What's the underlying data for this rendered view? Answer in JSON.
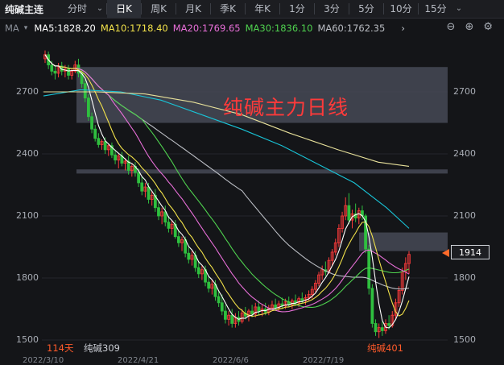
{
  "toolbar": {
    "title": "纯碱主连",
    "items": [
      {
        "label": "分时",
        "active": false,
        "width": 40,
        "chev": false
      },
      {
        "label": "⌄",
        "active": false,
        "width": 16,
        "chev": true
      },
      {
        "label": "日K",
        "active": true,
        "width": 42,
        "chev": false
      },
      {
        "label": "周K",
        "active": false,
        "width": 42,
        "chev": false
      },
      {
        "label": "月K",
        "active": false,
        "width": 42,
        "chev": false
      },
      {
        "label": "季K",
        "active": false,
        "width": 42,
        "chev": false
      },
      {
        "label": "年K",
        "active": false,
        "width": 42,
        "chev": false
      },
      {
        "label": "1分",
        "active": false,
        "width": 42,
        "chev": false
      },
      {
        "label": "3分",
        "active": false,
        "width": 42,
        "chev": false
      },
      {
        "label": "5分",
        "active": false,
        "width": 42,
        "chev": false
      },
      {
        "label": "10分",
        "active": false,
        "width": 42,
        "chev": false
      },
      {
        "label": "15分",
        "active": false,
        "width": 42,
        "chev": false
      },
      {
        "label": "⌄",
        "active": false,
        "width": 16,
        "chev": true
      }
    ]
  },
  "ma_bar": {
    "label": "MA",
    "caret": "▾",
    "items": [
      {
        "text": "MA5:1828.20",
        "color": "#ffffff"
      },
      {
        "text": "MA10:1718.40",
        "color": "#f2e24a"
      },
      {
        "text": "MA20:1769.65",
        "color": "#e86fd8"
      },
      {
        "text": "MA30:1836.10",
        "color": "#4fd24f"
      },
      {
        "text": "MA60:1762.35",
        "color": "#b9bcc2"
      }
    ],
    "arrow": "›",
    "tools": [
      "⊖",
      "⊕",
      "⚙"
    ]
  },
  "y_axis_labels": [
    "2700",
    "2400",
    "2100",
    "1800",
    "1500"
  ],
  "price_tag": "1914",
  "title": "纯碱主力日线",
  "bottom": {
    "days": "114天",
    "left_contract": "纯碱309",
    "right_contract": "纯碱401"
  },
  "dates": [
    "2022/3/10",
    "2022/4/21",
    "2022/6/6",
    "2022/7/19"
  ],
  "colors": {
    "up": "#ff3b3b",
    "down": "#2fbf3f",
    "ma5": "#ffffff",
    "ma10": "#f2e24a",
    "ma20": "#e86fd8",
    "ma30": "#4fd24f",
    "ma60": "#b9bcc2",
    "ma_long1": "#19c3d6",
    "ma_long2": "#e7e09a",
    "zone": "#484c5a"
  },
  "chart_data": {
    "type": "candlestick",
    "y_ticks": [
      2700,
      2400,
      2100,
      1800,
      1500
    ],
    "last_price": 1914,
    "zones": [
      [
        2550,
        2820
      ],
      [
        2305,
        2325
      ],
      [
        1930,
        2020
      ]
    ],
    "candles": [
      {
        "o": 2860,
        "h": 2900,
        "l": 2840,
        "c": 2880
      },
      {
        "o": 2880,
        "h": 2895,
        "l": 2810,
        "c": 2830
      },
      {
        "o": 2830,
        "h": 2850,
        "l": 2780,
        "c": 2800
      },
      {
        "o": 2800,
        "h": 2830,
        "l": 2760,
        "c": 2790
      },
      {
        "o": 2790,
        "h": 2840,
        "l": 2770,
        "c": 2825
      },
      {
        "o": 2825,
        "h": 2845,
        "l": 2780,
        "c": 2800
      },
      {
        "o": 2800,
        "h": 2830,
        "l": 2770,
        "c": 2810
      },
      {
        "o": 2810,
        "h": 2830,
        "l": 2760,
        "c": 2780
      },
      {
        "o": 2780,
        "h": 2810,
        "l": 2760,
        "c": 2800
      },
      {
        "o": 2800,
        "h": 2850,
        "l": 2790,
        "c": 2830
      },
      {
        "o": 2830,
        "h": 2860,
        "l": 2770,
        "c": 2790
      },
      {
        "o": 2790,
        "h": 2810,
        "l": 2720,
        "c": 2740
      },
      {
        "o": 2740,
        "h": 2760,
        "l": 2650,
        "c": 2670
      },
      {
        "o": 2670,
        "h": 2690,
        "l": 2560,
        "c": 2580
      },
      {
        "o": 2580,
        "h": 2600,
        "l": 2500,
        "c": 2520
      },
      {
        "o": 2520,
        "h": 2540,
        "l": 2460,
        "c": 2475
      },
      {
        "o": 2475,
        "h": 2500,
        "l": 2430,
        "c": 2445
      },
      {
        "o": 2445,
        "h": 2470,
        "l": 2420,
        "c": 2460
      },
      {
        "o": 2460,
        "h": 2480,
        "l": 2400,
        "c": 2420
      },
      {
        "o": 2420,
        "h": 2450,
        "l": 2390,
        "c": 2440
      },
      {
        "o": 2440,
        "h": 2455,
        "l": 2380,
        "c": 2395
      },
      {
        "o": 2395,
        "h": 2420,
        "l": 2350,
        "c": 2370
      },
      {
        "o": 2370,
        "h": 2400,
        "l": 2330,
        "c": 2390
      },
      {
        "o": 2390,
        "h": 2410,
        "l": 2340,
        "c": 2355
      },
      {
        "o": 2355,
        "h": 2380,
        "l": 2320,
        "c": 2365
      },
      {
        "o": 2365,
        "h": 2390,
        "l": 2300,
        "c": 2320
      },
      {
        "o": 2320,
        "h": 2350,
        "l": 2290,
        "c": 2340
      },
      {
        "o": 2340,
        "h": 2360,
        "l": 2290,
        "c": 2310
      },
      {
        "o": 2310,
        "h": 2330,
        "l": 2240,
        "c": 2260
      },
      {
        "o": 2260,
        "h": 2290,
        "l": 2200,
        "c": 2220
      },
      {
        "o": 2220,
        "h": 2260,
        "l": 2190,
        "c": 2240
      },
      {
        "o": 2240,
        "h": 2260,
        "l": 2160,
        "c": 2180
      },
      {
        "o": 2180,
        "h": 2220,
        "l": 2150,
        "c": 2200
      },
      {
        "o": 2200,
        "h": 2230,
        "l": 2120,
        "c": 2140
      },
      {
        "o": 2140,
        "h": 2170,
        "l": 2080,
        "c": 2100
      },
      {
        "o": 2100,
        "h": 2140,
        "l": 2060,
        "c": 2120
      },
      {
        "o": 2120,
        "h": 2150,
        "l": 2050,
        "c": 2070
      },
      {
        "o": 2070,
        "h": 2100,
        "l": 2020,
        "c": 2040
      },
      {
        "o": 2040,
        "h": 2080,
        "l": 2010,
        "c": 2060
      },
      {
        "o": 2060,
        "h": 2080,
        "l": 1990,
        "c": 2000
      },
      {
        "o": 2000,
        "h": 2030,
        "l": 1950,
        "c": 1970
      },
      {
        "o": 1970,
        "h": 2000,
        "l": 1930,
        "c": 1985
      },
      {
        "o": 1985,
        "h": 2000,
        "l": 1900,
        "c": 1920
      },
      {
        "o": 1920,
        "h": 1950,
        "l": 1870,
        "c": 1890
      },
      {
        "o": 1890,
        "h": 1930,
        "l": 1860,
        "c": 1910
      },
      {
        "o": 1910,
        "h": 1930,
        "l": 1830,
        "c": 1850
      },
      {
        "o": 1850,
        "h": 1880,
        "l": 1800,
        "c": 1820
      },
      {
        "o": 1820,
        "h": 1860,
        "l": 1790,
        "c": 1840
      },
      {
        "o": 1840,
        "h": 1860,
        "l": 1760,
        "c": 1780
      },
      {
        "o": 1780,
        "h": 1810,
        "l": 1730,
        "c": 1750
      },
      {
        "o": 1750,
        "h": 1790,
        "l": 1720,
        "c": 1770
      },
      {
        "o": 1770,
        "h": 1790,
        "l": 1690,
        "c": 1710
      },
      {
        "o": 1710,
        "h": 1740,
        "l": 1660,
        "c": 1680
      },
      {
        "o": 1680,
        "h": 1720,
        "l": 1620,
        "c": 1640
      },
      {
        "o": 1640,
        "h": 1670,
        "l": 1580,
        "c": 1600
      },
      {
        "o": 1600,
        "h": 1640,
        "l": 1570,
        "c": 1620
      },
      {
        "o": 1620,
        "h": 1650,
        "l": 1560,
        "c": 1580
      },
      {
        "o": 1580,
        "h": 1630,
        "l": 1560,
        "c": 1610
      },
      {
        "o": 1610,
        "h": 1640,
        "l": 1570,
        "c": 1590
      },
      {
        "o": 1590,
        "h": 1650,
        "l": 1580,
        "c": 1630
      },
      {
        "o": 1630,
        "h": 1660,
        "l": 1600,
        "c": 1615
      },
      {
        "o": 1615,
        "h": 1650,
        "l": 1590,
        "c": 1640
      },
      {
        "o": 1640,
        "h": 1670,
        "l": 1610,
        "c": 1625
      },
      {
        "o": 1625,
        "h": 1680,
        "l": 1610,
        "c": 1660
      },
      {
        "o": 1660,
        "h": 1690,
        "l": 1620,
        "c": 1640
      },
      {
        "o": 1640,
        "h": 1670,
        "l": 1615,
        "c": 1650
      },
      {
        "o": 1650,
        "h": 1680,
        "l": 1620,
        "c": 1635
      },
      {
        "o": 1635,
        "h": 1670,
        "l": 1620,
        "c": 1655
      },
      {
        "o": 1655,
        "h": 1690,
        "l": 1640,
        "c": 1670
      },
      {
        "o": 1670,
        "h": 1700,
        "l": 1640,
        "c": 1655
      },
      {
        "o": 1655,
        "h": 1690,
        "l": 1640,
        "c": 1675
      },
      {
        "o": 1675,
        "h": 1705,
        "l": 1650,
        "c": 1665
      },
      {
        "o": 1665,
        "h": 1700,
        "l": 1650,
        "c": 1685
      },
      {
        "o": 1685,
        "h": 1710,
        "l": 1660,
        "c": 1670
      },
      {
        "o": 1670,
        "h": 1700,
        "l": 1650,
        "c": 1690
      },
      {
        "o": 1690,
        "h": 1720,
        "l": 1670,
        "c": 1680
      },
      {
        "o": 1680,
        "h": 1710,
        "l": 1660,
        "c": 1700
      },
      {
        "o": 1700,
        "h": 1730,
        "l": 1680,
        "c": 1690
      },
      {
        "o": 1690,
        "h": 1720,
        "l": 1670,
        "c": 1705
      },
      {
        "o": 1705,
        "h": 1740,
        "l": 1690,
        "c": 1720
      },
      {
        "o": 1720,
        "h": 1760,
        "l": 1700,
        "c": 1745
      },
      {
        "o": 1745,
        "h": 1790,
        "l": 1730,
        "c": 1775
      },
      {
        "o": 1775,
        "h": 1830,
        "l": 1760,
        "c": 1815
      },
      {
        "o": 1815,
        "h": 1860,
        "l": 1790,
        "c": 1840
      },
      {
        "o": 1840,
        "h": 1880,
        "l": 1810,
        "c": 1830
      },
      {
        "o": 1830,
        "h": 1900,
        "l": 1820,
        "c": 1885
      },
      {
        "o": 1885,
        "h": 1940,
        "l": 1860,
        "c": 1925
      },
      {
        "o": 1925,
        "h": 1990,
        "l": 1910,
        "c": 1970
      },
      {
        "o": 1970,
        "h": 2060,
        "l": 1950,
        "c": 2040
      },
      {
        "o": 2040,
        "h": 2120,
        "l": 2020,
        "c": 2100
      },
      {
        "o": 2100,
        "h": 2190,
        "l": 2080,
        "c": 2150
      },
      {
        "o": 2150,
        "h": 2210,
        "l": 2060,
        "c": 2080
      },
      {
        "o": 2080,
        "h": 2130,
        "l": 2040,
        "c": 2110
      },
      {
        "o": 2110,
        "h": 2160,
        "l": 2070,
        "c": 2090
      },
      {
        "o": 2090,
        "h": 2140,
        "l": 2060,
        "c": 2125
      },
      {
        "o": 2125,
        "h": 2150,
        "l": 2080,
        "c": 2100
      },
      {
        "o": 2100,
        "h": 2110,
        "l": 1920,
        "c": 1940
      },
      {
        "o": 1940,
        "h": 1960,
        "l": 1720,
        "c": 1750
      },
      {
        "o": 1750,
        "h": 1770,
        "l": 1560,
        "c": 1580
      },
      {
        "o": 1580,
        "h": 1600,
        "l": 1520,
        "c": 1540
      },
      {
        "o": 1540,
        "h": 1580,
        "l": 1510,
        "c": 1560
      },
      {
        "o": 1560,
        "h": 1590,
        "l": 1520,
        "c": 1545
      },
      {
        "o": 1545,
        "h": 1600,
        "l": 1530,
        "c": 1580
      },
      {
        "o": 1580,
        "h": 1620,
        "l": 1550,
        "c": 1570
      },
      {
        "o": 1570,
        "h": 1640,
        "l": 1560,
        "c": 1620
      },
      {
        "o": 1620,
        "h": 1700,
        "l": 1600,
        "c": 1680
      },
      {
        "o": 1680,
        "h": 1760,
        "l": 1660,
        "c": 1740
      },
      {
        "o": 1740,
        "h": 1850,
        "l": 1720,
        "c": 1830
      },
      {
        "o": 1830,
        "h": 1900,
        "l": 1790,
        "c": 1870
      },
      {
        "o": 1870,
        "h": 1930,
        "l": 1820,
        "c": 1914
      }
    ]
  }
}
